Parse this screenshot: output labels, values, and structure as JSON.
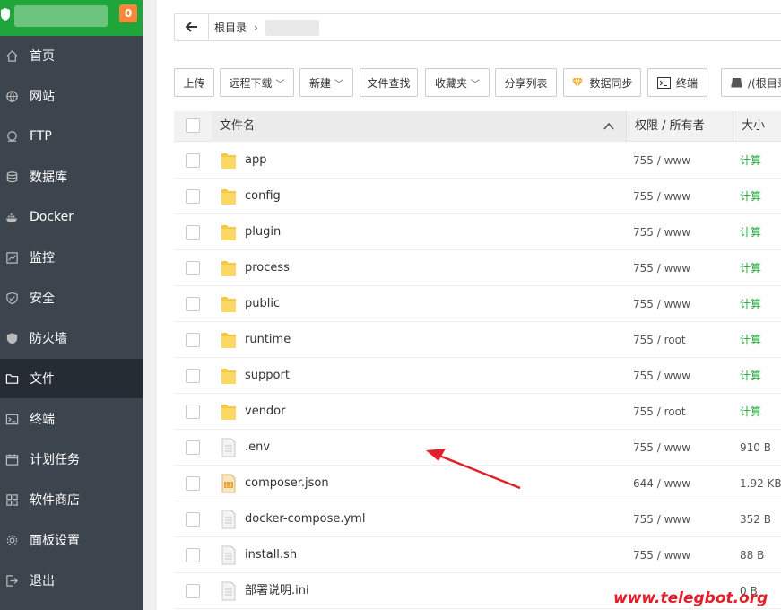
{
  "sidebar": {
    "badge": "0",
    "items": [
      {
        "label": "首页",
        "icon": "home-icon"
      },
      {
        "label": "网站",
        "icon": "globe-icon"
      },
      {
        "label": "FTP",
        "icon": "ftp-icon"
      },
      {
        "label": "数据库",
        "icon": "database-icon"
      },
      {
        "label": "Docker",
        "icon": "docker-icon"
      },
      {
        "label": "监控",
        "icon": "monitor-icon"
      },
      {
        "label": "安全",
        "icon": "shield-icon"
      },
      {
        "label": "防火墙",
        "icon": "firewall-icon"
      },
      {
        "label": "文件",
        "icon": "folder-icon"
      },
      {
        "label": "终端",
        "icon": "terminal-icon"
      },
      {
        "label": "计划任务",
        "icon": "calendar-icon"
      },
      {
        "label": "软件商店",
        "icon": "apps-icon"
      },
      {
        "label": "面板设置",
        "icon": "gear-icon"
      },
      {
        "label": "退出",
        "icon": "logout-icon"
      }
    ],
    "active_index": 8
  },
  "pathbar": {
    "root_label": "根目录"
  },
  "toolbar": {
    "upload": "上传",
    "remote_download": "远程下载",
    "new": "新建",
    "file_search": "文件查找",
    "favorites": "收藏夹",
    "share_list": "分享列表",
    "data_sync": "数据同步",
    "terminal": "终端",
    "disk": "/(根目录"
  },
  "table": {
    "headers": {
      "name": "文件名",
      "perm": "权限 / 所有者",
      "size": "大小"
    },
    "rows": [
      {
        "name": "app",
        "type": "folder",
        "perm": "755 / www",
        "size": "计算"
      },
      {
        "name": "config",
        "type": "folder",
        "perm": "755 / www",
        "size": "计算"
      },
      {
        "name": "plugin",
        "type": "folder",
        "perm": "755 / www",
        "size": "计算"
      },
      {
        "name": "process",
        "type": "folder",
        "perm": "755 / www",
        "size": "计算"
      },
      {
        "name": "public",
        "type": "folder",
        "perm": "755 / www",
        "size": "计算"
      },
      {
        "name": "runtime",
        "type": "folder",
        "perm": "755 / root",
        "size": "计算"
      },
      {
        "name": "support",
        "type": "folder",
        "perm": "755 / www",
        "size": "计算"
      },
      {
        "name": "vendor",
        "type": "folder",
        "perm": "755 / root",
        "size": "计算"
      },
      {
        "name": ".env",
        "type": "file",
        "perm": "755 / www",
        "size": "910 B"
      },
      {
        "name": "composer.json",
        "type": "json",
        "perm": "644 / www",
        "size": "1.92 KB"
      },
      {
        "name": "docker-compose.yml",
        "type": "file",
        "perm": "755 / www",
        "size": "352 B"
      },
      {
        "name": "install.sh",
        "type": "file",
        "perm": "755 / www",
        "size": "88 B"
      },
      {
        "name": "部署说明.ini",
        "type": "file",
        "perm": "",
        "size": "0 B"
      }
    ]
  },
  "watermark": "www.telegbot.org",
  "colors": {
    "sidebar_bg": "#3c444d",
    "sidebar_active": "#262c33",
    "brand_green": "#20a53a",
    "badge_orange": "#f7883a",
    "arrow_red": "#e0202a"
  }
}
